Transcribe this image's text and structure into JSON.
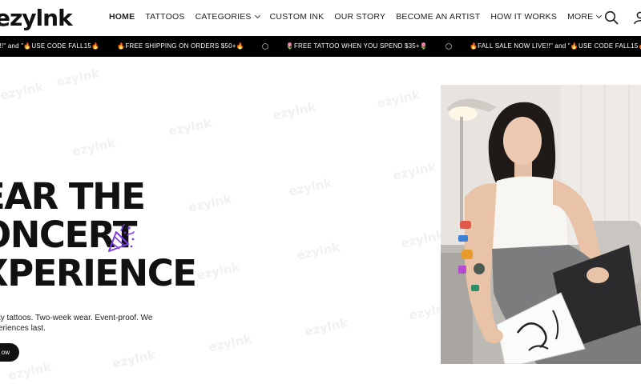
{
  "brand": {
    "logo_text": "ezylnk"
  },
  "nav": {
    "items": [
      {
        "label": "HOME",
        "active": true,
        "dropdown": false
      },
      {
        "label": "TATTOOS",
        "active": false,
        "dropdown": false
      },
      {
        "label": "CATEGORIES",
        "active": false,
        "dropdown": true
      },
      {
        "label": "CUSTOM INK",
        "active": false,
        "dropdown": false
      },
      {
        "label": "OUR STORY",
        "active": false,
        "dropdown": false
      },
      {
        "label": "BECOME AN ARTIST",
        "active": false,
        "dropdown": false
      },
      {
        "label": "HOW IT WORKS",
        "active": false,
        "dropdown": false
      },
      {
        "label": "MORE",
        "active": false,
        "dropdown": true
      }
    ],
    "icons": {
      "search": "search-icon",
      "account": "user-icon"
    }
  },
  "announcement": {
    "messages": [
      "E!!\" and \"🔥USE CODE FALL15🔥",
      "🔥FREE SHIPPING ON ORDERS $50+🔥",
      "🌷FREE TATTOO WHEN YOU SPEND $35+🌷",
      "🔥FALL SALE NOW LIVE!!\" and \"🔥USE CODE FALL15🔥"
    ],
    "background": "#000000",
    "text_color": "#ffffff"
  },
  "hero": {
    "title_lines": [
      "EAR THE",
      "ONCERT",
      "XPERIENCE"
    ],
    "subtitle": "ty tattoos. Two-week wear. Event-proof. We eriences last.",
    "cta_label": "ow",
    "decor_icon": "party-popper-icon",
    "accent_color": "#7b3fe4",
    "watermark_text": "ezylnk"
  },
  "hero_image": {
    "alt": "Woman with colorful temporary tattoos sitting on a couch with tattoo sketches"
  }
}
